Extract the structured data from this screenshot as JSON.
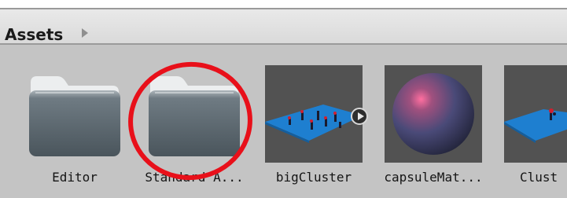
{
  "breadcrumb": {
    "label": "Assets",
    "arrow_icon": "chevron-right-icon"
  },
  "assets": [
    {
      "name": "Editor",
      "type": "folder",
      "icon": "folder-icon"
    },
    {
      "name": "Standard A...",
      "type": "folder",
      "icon": "folder-icon"
    },
    {
      "name": "bigCluster",
      "type": "prefab",
      "icon": "prefab-preview-icon"
    },
    {
      "name": "capsuleMat...",
      "type": "material",
      "icon": "material-sphere-icon"
    },
    {
      "name": "Clust",
      "type": "prefab",
      "icon": "prefab-preview-icon"
    }
  ],
  "annotation": {
    "shape": "ellipse",
    "color": "#e8101a",
    "target": "Standard A..."
  },
  "colors": {
    "panel_bg": "#c4c4c4",
    "preview_bg": "#525252",
    "folder": "#5d6a72"
  }
}
